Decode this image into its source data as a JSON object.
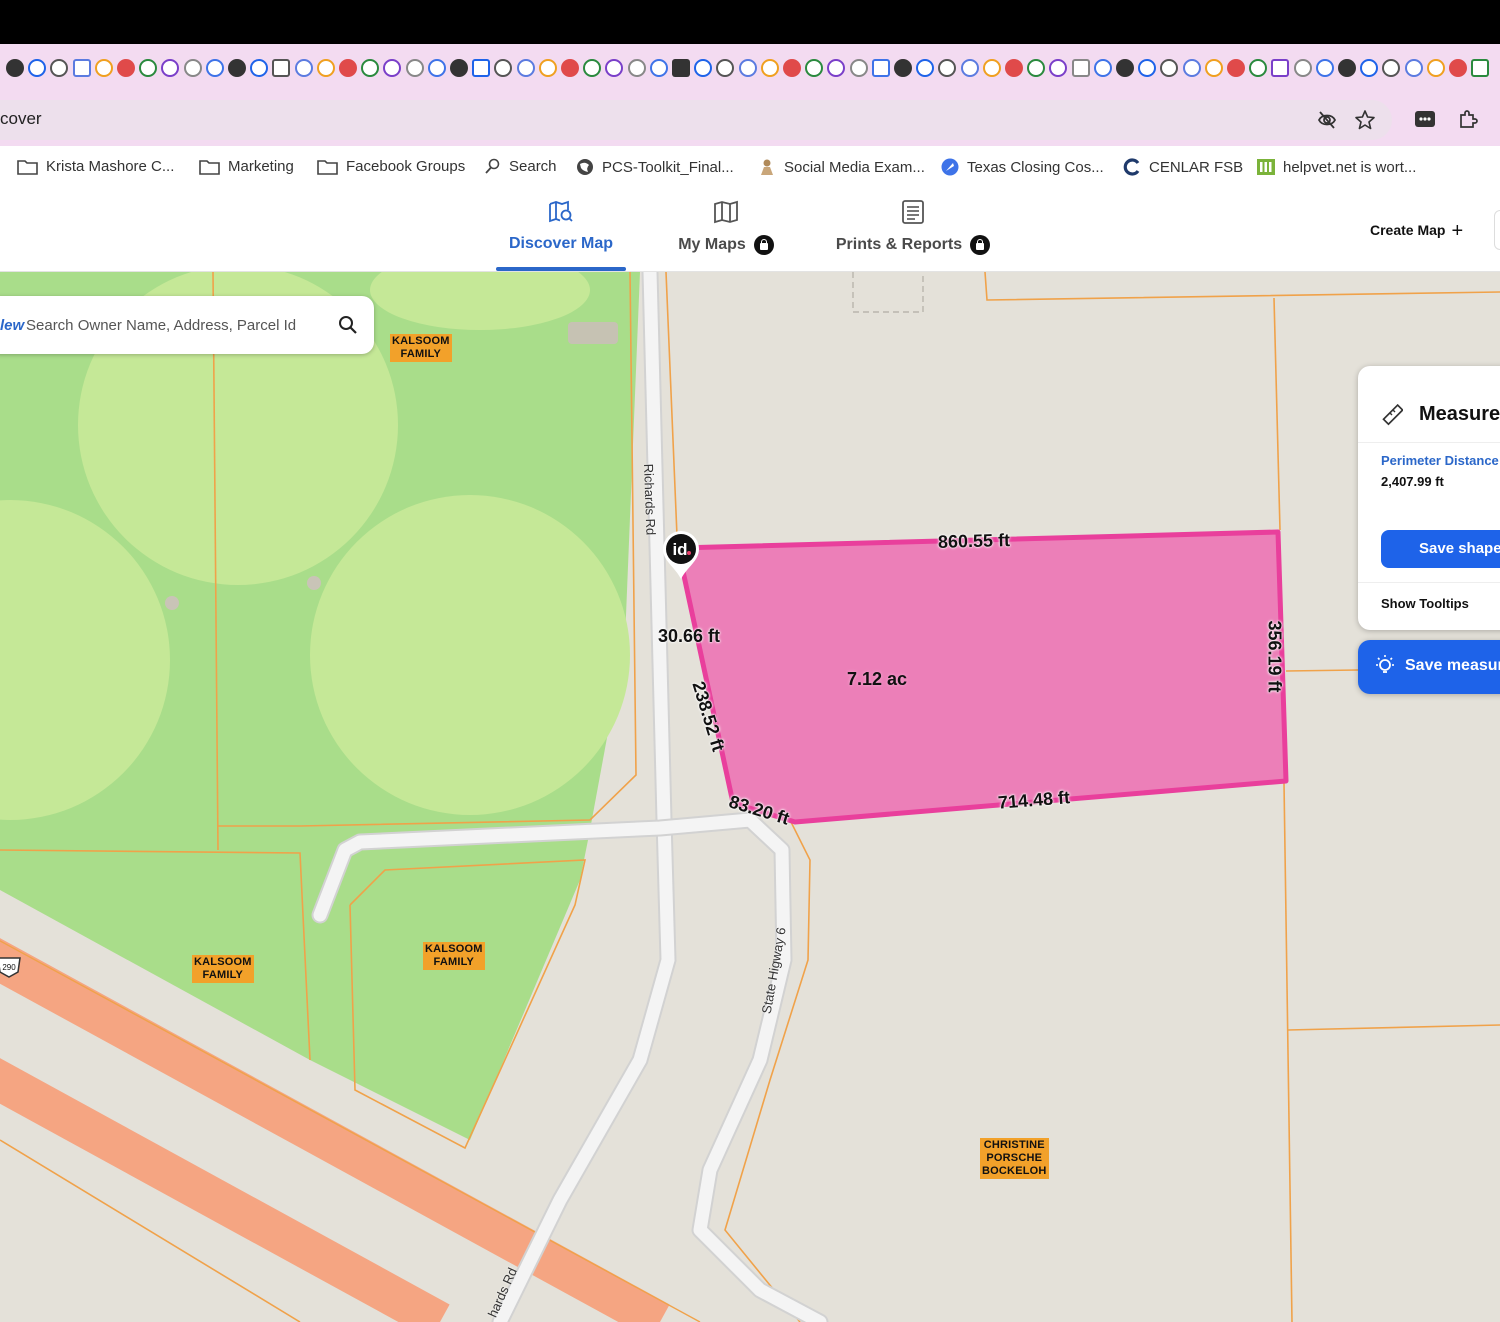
{
  "browser": {
    "address_url": "cover",
    "bookmarks": [
      {
        "label": "Krista Mashore C...",
        "icon": "folder-icon"
      },
      {
        "label": "Marketing",
        "icon": "folder-icon"
      },
      {
        "label": "Facebook Groups",
        "icon": "folder-icon"
      },
      {
        "label": "Search",
        "icon": "search-icon"
      },
      {
        "label": "PCS-Toolkit_Final...",
        "icon": "globe-icon"
      },
      {
        "label": "Social Media Exam...",
        "icon": "figure-icon"
      },
      {
        "label": "Texas Closing Cos...",
        "icon": "blue-circle-icon"
      },
      {
        "label": "CENLAR FSB",
        "icon": "c-logo-icon"
      },
      {
        "label": "helpvet.net is wort...",
        "icon": "green-bars-icon"
      }
    ]
  },
  "app": {
    "tabs": [
      {
        "label": "Discover Map",
        "active": true,
        "locked": false
      },
      {
        "label": "My Maps",
        "active": false,
        "locked": true
      },
      {
        "label": "Prints & Reports",
        "active": false,
        "locked": true
      }
    ],
    "create_map_label": "Create Map",
    "search": {
      "new_badge": "lew",
      "placeholder": "Search Owner Name, Address, Parcel Id"
    }
  },
  "map": {
    "owner_labels": [
      {
        "lines": [
          "KALSOOM",
          "FAMILY"
        ]
      },
      {
        "lines": [
          "KALSOOM",
          "FAMILY"
        ]
      },
      {
        "lines": [
          "KALSOOM",
          "FAMILY"
        ]
      },
      {
        "lines": [
          "CHRISTINE",
          "PORSCHE",
          "BOCKELOH"
        ]
      }
    ],
    "road_labels": {
      "richards_top": "Richards Rd",
      "state_highway": "State Higway 6",
      "richards_bottom": "hards Rd",
      "shield": "290"
    },
    "measurements": {
      "top": "860.55 ft",
      "right": "356.19 ft",
      "bottom": "714.48 ft",
      "bottom_left": "83.20 ft",
      "left_diag": "238.52 ft",
      "left_top": "30.66 ft",
      "area": "7.12 ac"
    },
    "polygon_color": "#ec7fb8",
    "polygon_stroke": "#e93f9c",
    "pin_label": "id"
  },
  "measure_panel": {
    "title": "Measure",
    "perimeter_label": "Perimeter Distance",
    "perimeter_value": "2,407.99 ft",
    "save_shape_label": "Save shape",
    "show_tooltips_label": "Show Tooltips",
    "save_measure_label": "Save measur"
  }
}
